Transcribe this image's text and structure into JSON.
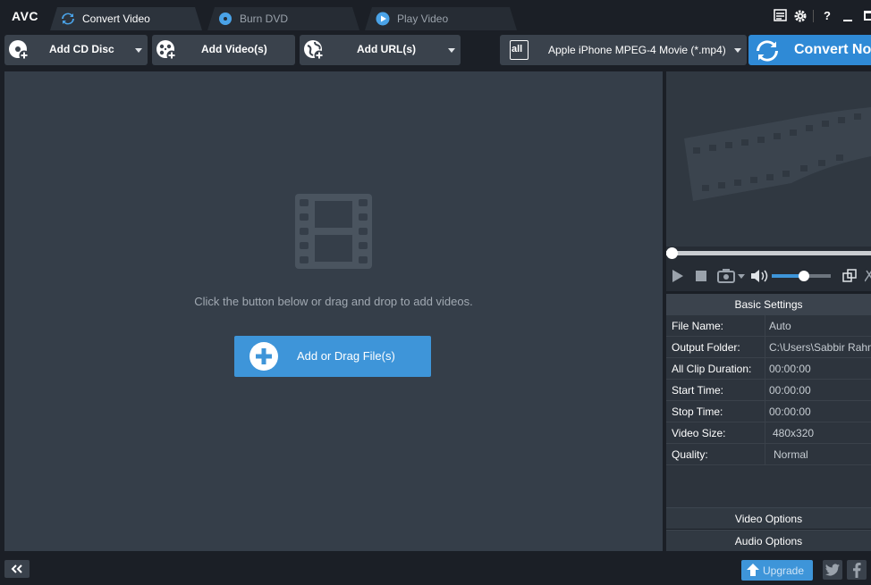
{
  "app": {
    "logo": "AVC"
  },
  "tabs": [
    {
      "label": "Convert Video",
      "active": true
    },
    {
      "label": "Burn DVD",
      "active": false
    },
    {
      "label": "Play Video",
      "active": false
    }
  ],
  "window_controls": {
    "help": "?"
  },
  "toolbar": {
    "add_cd_label": "Add CD Disc",
    "add_video_label": "Add Video(s)",
    "add_url_label": "Add URL(s)",
    "profile_label": "Apple iPhone MPEG-4 Movie (*.mp4)",
    "profile_icon_text": "all",
    "convert_label": "Convert Now"
  },
  "main": {
    "hint": "Click the button below or drag and drop to add videos.",
    "add_button_label": "Add or Drag File(s)"
  },
  "player": {
    "volume": 0.55,
    "progress": 0.0
  },
  "settings": {
    "header": "Basic Settings",
    "rows": [
      {
        "key": "File Name:",
        "value": "Auto"
      },
      {
        "key": "Output Folder:",
        "value": "C:\\Users\\Sabbir Rahm"
      },
      {
        "key": "All Clip Duration:",
        "value": "00:00:00"
      },
      {
        "key": "Start Time:",
        "value": "00:00:00"
      },
      {
        "key": "Stop Time:",
        "value": "00:00:00"
      },
      {
        "key": "Video Size:",
        "value": "480x320"
      },
      {
        "key": "Quality:",
        "value": "Normal"
      }
    ],
    "video_options": "Video Options",
    "audio_options": "Audio Options"
  },
  "bottom": {
    "upgrade_label": "Upgrade"
  },
  "colors": {
    "accent": "#3e95d9",
    "convert": "#2f8ad6",
    "panel": "#353e49",
    "background": "#1b1f26"
  }
}
